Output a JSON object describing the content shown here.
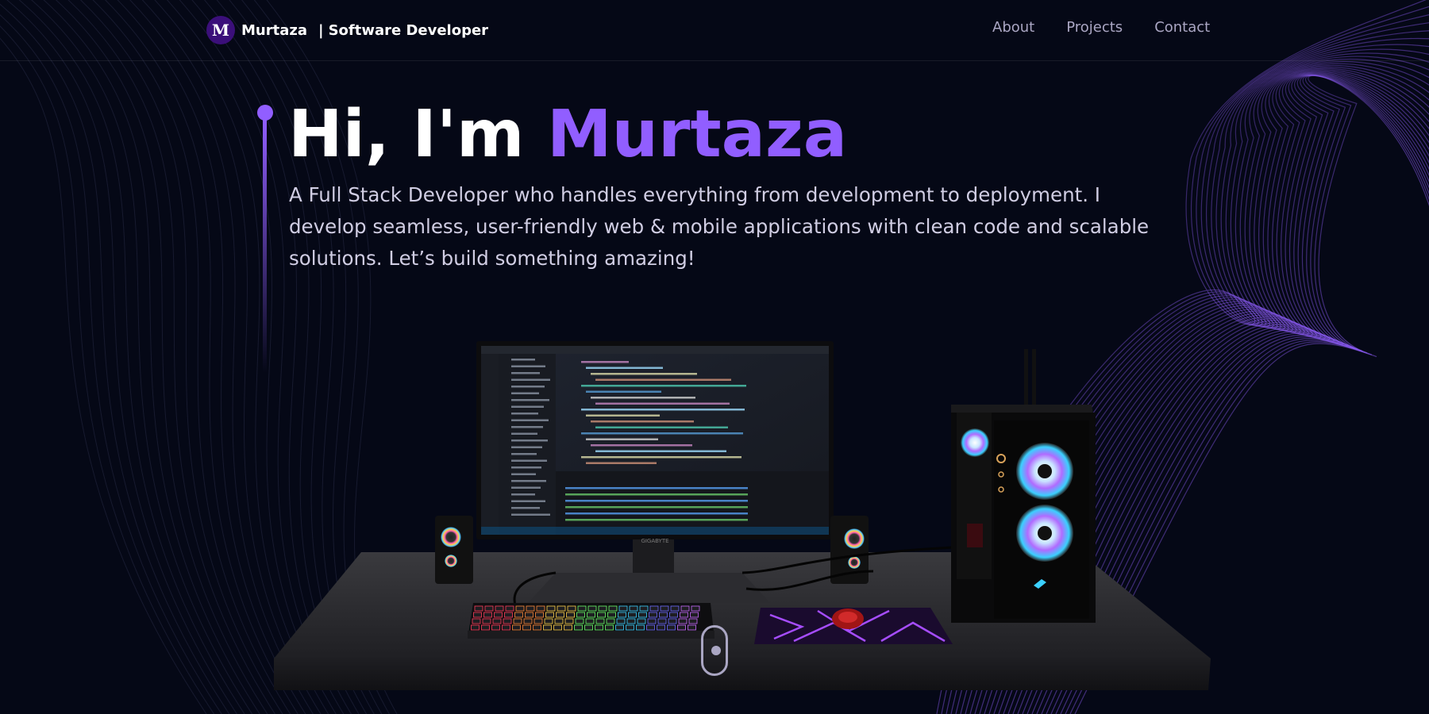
{
  "brand": {
    "logo_letter": "M",
    "name": "Murtaza",
    "separator": "|",
    "role": "Software Developer"
  },
  "nav": {
    "links": [
      "About",
      "Projects",
      "Contact"
    ]
  },
  "hero": {
    "greeting": "Hi, I'm ",
    "name": "Murtaza",
    "description": "A Full Stack Developer who handles everything from development to deployment. I develop seamless, user-friendly web & mobile applications with clean code and scalable solutions. Let’s build something amazing!"
  },
  "colors": {
    "background": "#050816",
    "accent": "#915eff",
    "secondary_text": "#aaa6c3"
  },
  "icons": {
    "scroll": "mouse-scroll-icon"
  }
}
